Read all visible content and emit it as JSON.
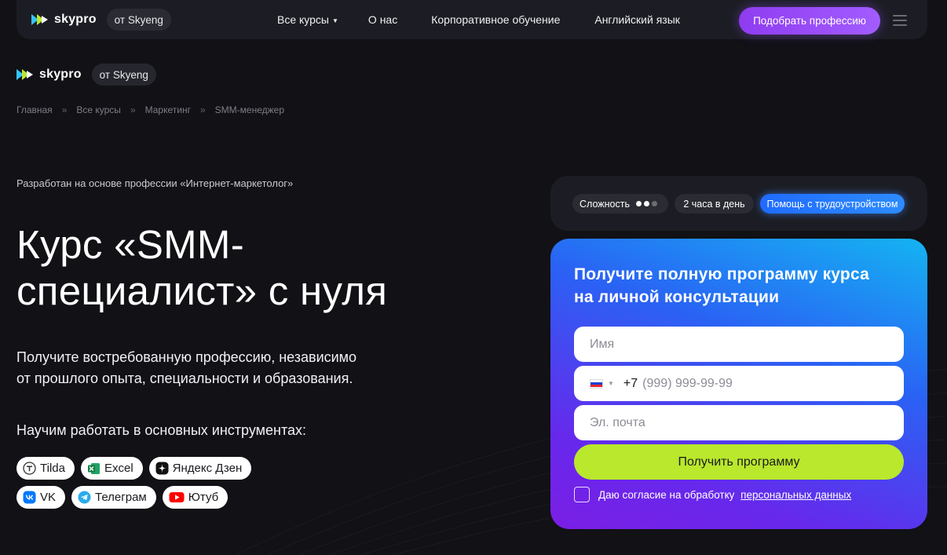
{
  "brand": {
    "logo_text": "skypro",
    "from_label": "от Skyeng"
  },
  "nav": {
    "items": [
      {
        "label": "Все курсы"
      },
      {
        "label": "О нас"
      },
      {
        "label": "Корпоративное обучение"
      },
      {
        "label": "Английский язык"
      }
    ],
    "cta_label": "Подобрать профессию"
  },
  "breadcrumbs": [
    "Главная",
    "Все курсы",
    "Маркетинг",
    "SMM-менеджер"
  ],
  "breadcrumb_separator": "»",
  "hero": {
    "based_on": "Разработан на основе профессии «Интернет-маркетолог»",
    "title_line1": "Курс «SMM-",
    "title_line2": "специалист» с нуля",
    "description_line1": "Получите востребованную профессию, независимо",
    "description_line2": "от прошлого опыта, специальности и образования.",
    "tools_title": "Научим работать в основных инструментах:"
  },
  "tools": [
    {
      "label": "Tilda",
      "icon": "tilda-icon"
    },
    {
      "label": "Excel",
      "icon": "excel-icon"
    },
    {
      "label": "Яндекс Дзен",
      "icon": "dzen-icon"
    },
    {
      "label": "VK",
      "icon": "vk-icon"
    },
    {
      "label": "Телеграм",
      "icon": "telegram-icon"
    },
    {
      "label": "Ютуб",
      "icon": "youtube-icon"
    }
  ],
  "badges": {
    "complexity_label": "Сложность",
    "complexity_level": 2,
    "complexity_max": 3,
    "hours": "2 часа в день",
    "job_help": "Помощь с трудоустройством"
  },
  "form": {
    "title_line1": "Получите полную программу курса",
    "title_line2": "на личной консультации",
    "name_placeholder": "Имя",
    "phone_prefix": "+7",
    "phone_placeholder": "(999) 999-99-99",
    "email_placeholder": "Эл. почта",
    "submit_label": "Получить программу",
    "consent_text": "Даю согласие на обработку",
    "consent_link": "персональных данных"
  },
  "colors": {
    "background": "#111116",
    "cta_purple": "#9a4dff",
    "accent_lime": "#b9e82c",
    "badge_blue": "#2478ff"
  }
}
